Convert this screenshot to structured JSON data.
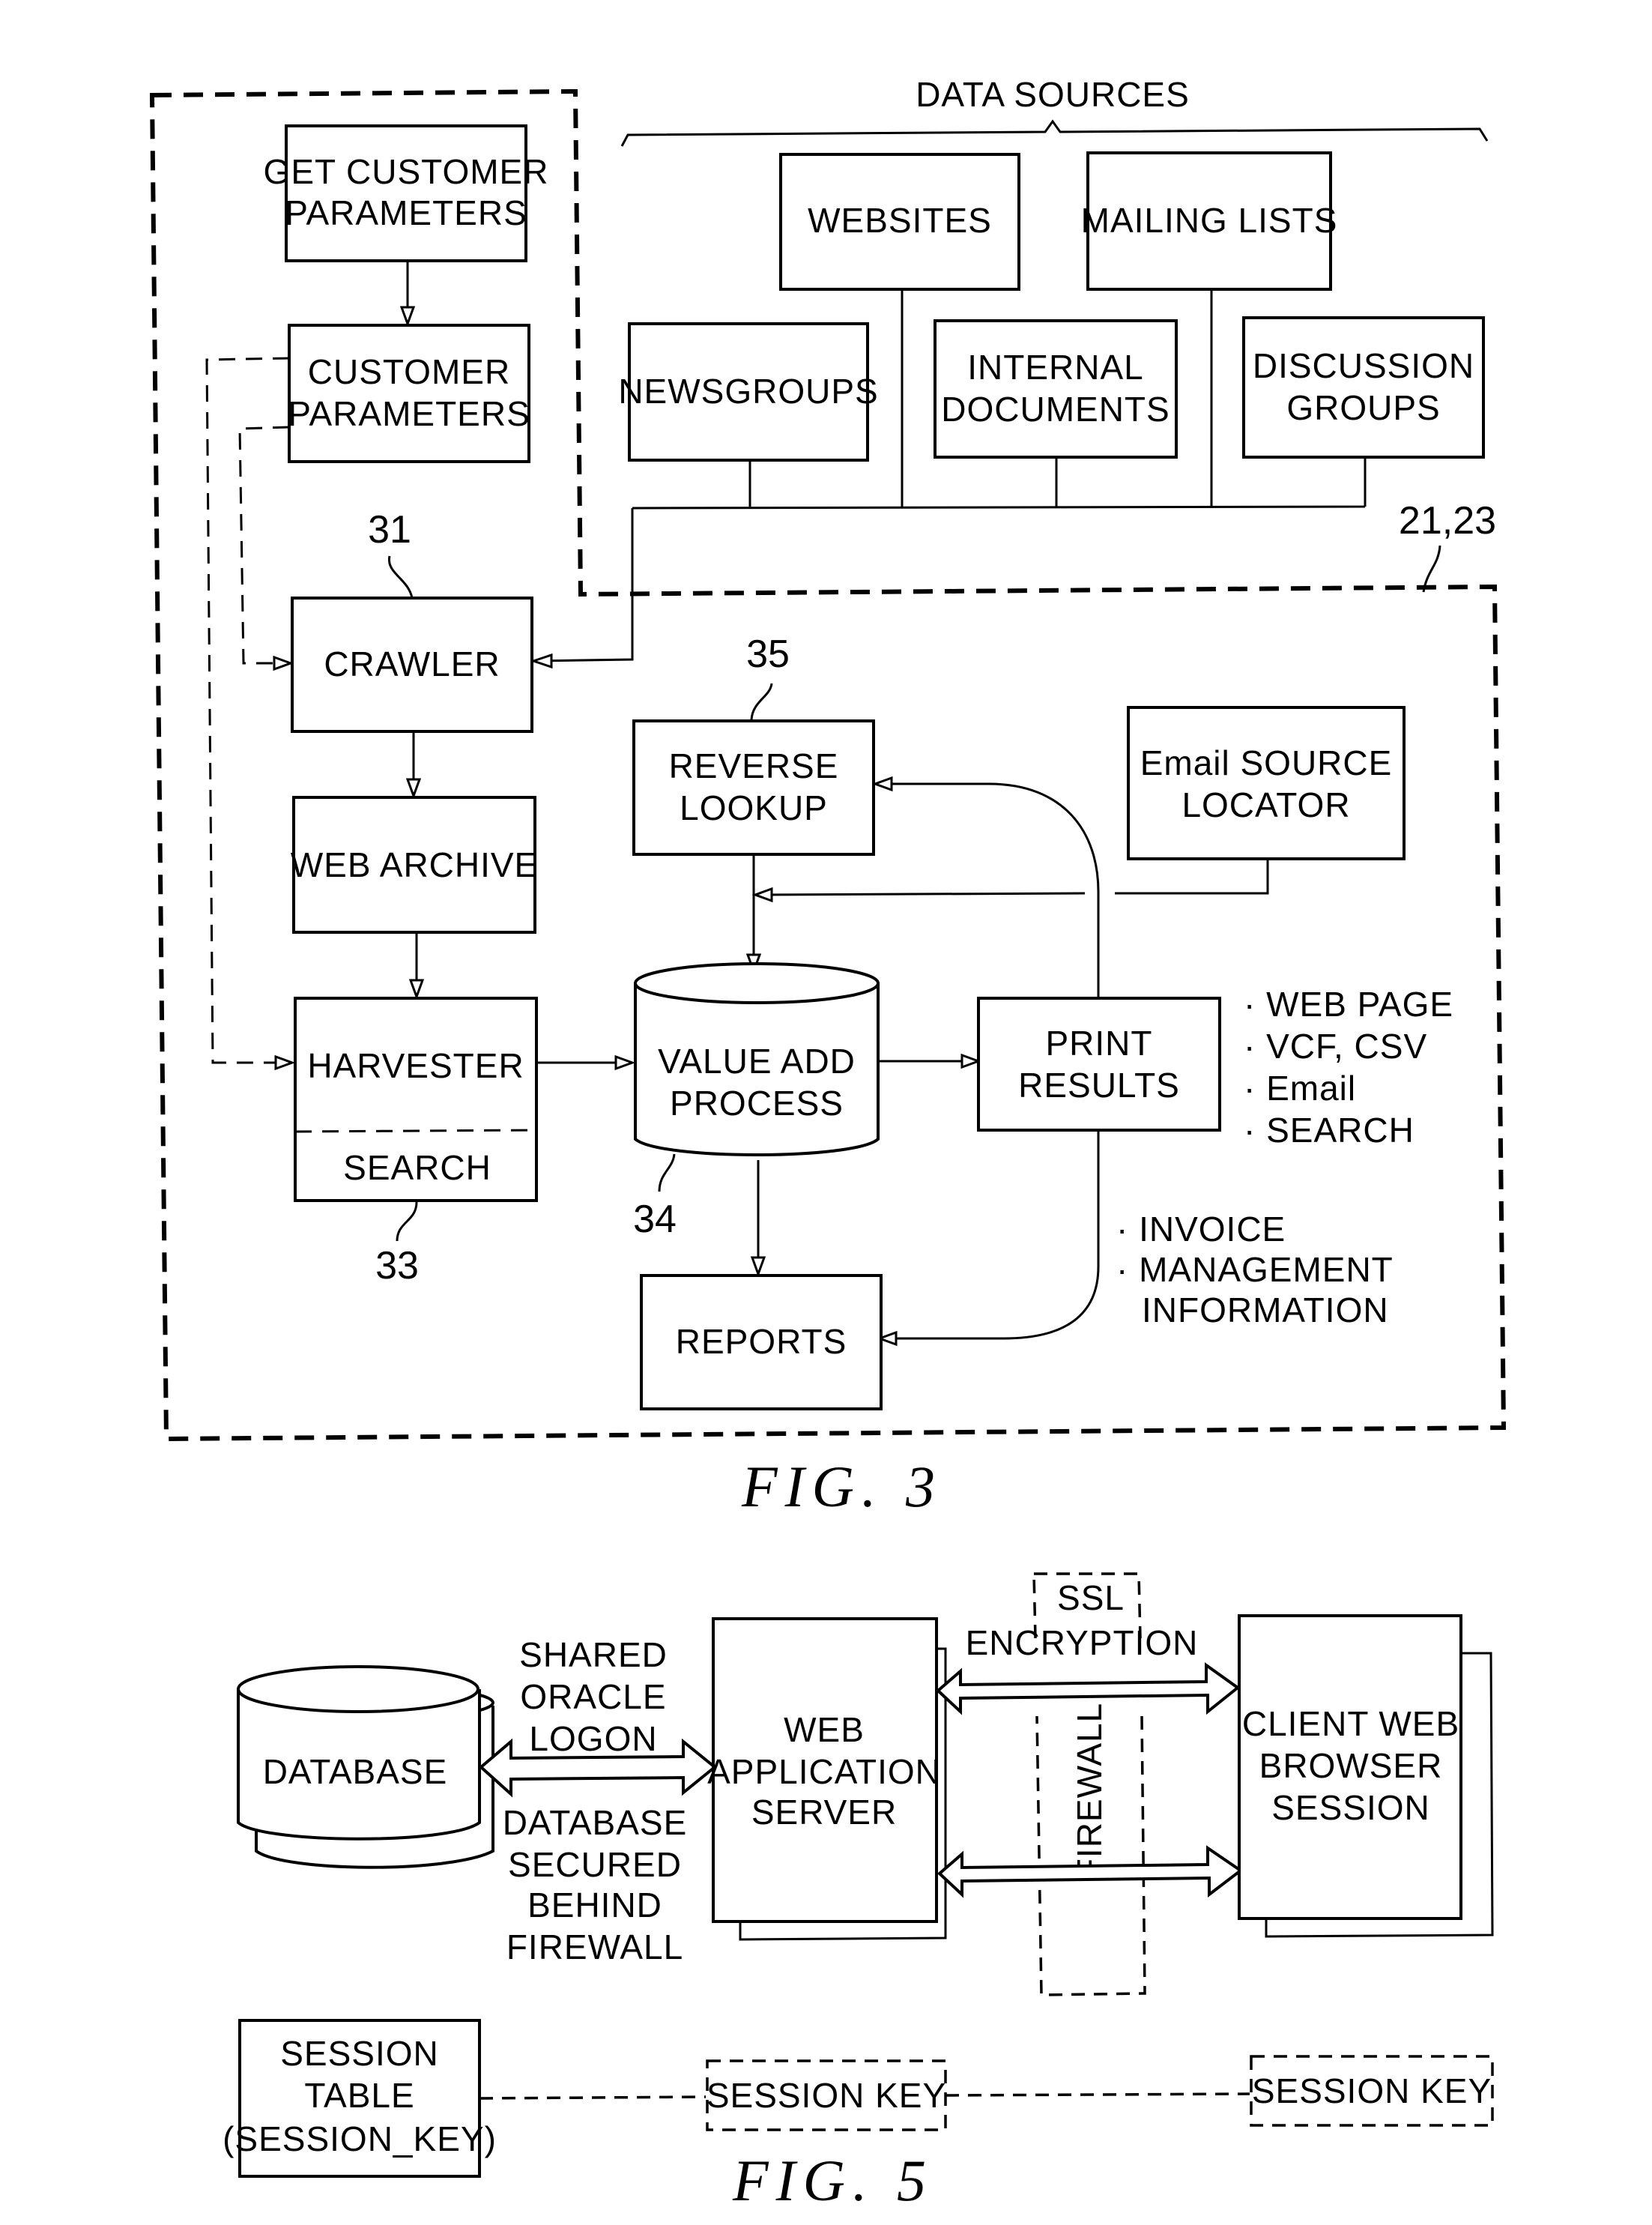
{
  "fig3": {
    "caption": "FIG. 3",
    "data_sources_label": "DATA SOURCES",
    "system_ref": "21,23",
    "sources": {
      "websites": "WEBSITES",
      "mailing_lists": "MAILING LISTS",
      "newsgroups": "NEWSGROUPS",
      "internal_documents": [
        "INTERNAL",
        "DOCUMENTS"
      ],
      "discussion_groups": [
        "DISCUSSION",
        "GROUPS"
      ]
    },
    "get_customer_parameters": [
      "GET CUSTOMER",
      "PARAMETERS"
    ],
    "customer_parameters": [
      "CUSTOMER",
      "PARAMETERS"
    ],
    "crawler": {
      "label": "CRAWLER",
      "ref": "31"
    },
    "web_archive": "WEB ARCHIVE",
    "harvester": {
      "label": "HARVESTER",
      "sub": "SEARCH",
      "ref": "33"
    },
    "reverse_lookup": {
      "label": [
        "REVERSE",
        "LOOKUP"
      ],
      "ref": "35"
    },
    "email_source_locator": [
      "Email SOURCE",
      "LOCATOR"
    ],
    "value_add_process": {
      "label": [
        "VALUE ADD",
        "PROCESS"
      ],
      "ref": "34"
    },
    "print_results": [
      "PRINT",
      "RESULTS"
    ],
    "reports": "REPORTS",
    "output_formats": [
      "· WEB PAGE",
      "· VCF, CSV",
      "· Email",
      "· SEARCH"
    ],
    "report_items": [
      "· INVOICE",
      "· MANAGEMENT",
      "INFORMATION"
    ]
  },
  "fig5": {
    "caption": "FIG. 5",
    "database": "DATABASE",
    "shared_logon": [
      "SHARED",
      "ORACLE",
      "LOGON"
    ],
    "db_secured": [
      "DATABASE",
      "SECURED",
      "BEHIND",
      "FIREWALL"
    ],
    "web_app_server": [
      "WEB",
      "APPLICATION",
      "SERVER"
    ],
    "ssl": [
      "SSL",
      "ENCRYPTION"
    ],
    "firewall": "FIREWALL",
    "client_browser": [
      "CLIENT WEB",
      "BROWSER",
      "SESSION"
    ],
    "session_table": [
      "SESSION",
      "TABLE",
      "(SESSION_KEY)"
    ],
    "session_key_1": "SESSION KEY",
    "session_key_2": "SESSION KEY"
  }
}
